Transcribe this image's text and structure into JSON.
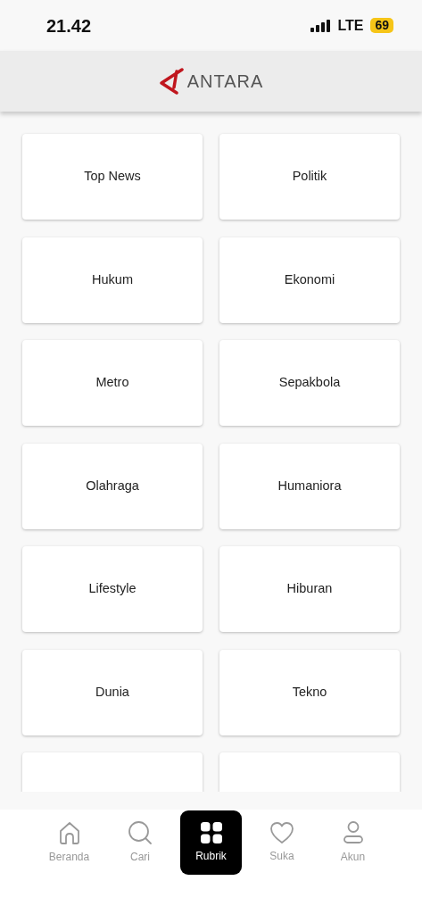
{
  "status_bar": {
    "time": "21.42",
    "network": "LTE",
    "battery": "69"
  },
  "header": {
    "logo_text": "ANTARA"
  },
  "categories": [
    {
      "kind": "card",
      "label": "Top News"
    },
    {
      "kind": "card",
      "label": "Politik"
    },
    {
      "kind": "card",
      "label": "Hukum"
    },
    {
      "kind": "card",
      "label": "Ekonomi"
    },
    {
      "kind": "card",
      "label": "Metro"
    },
    {
      "kind": "card",
      "label": "Sepakbola"
    },
    {
      "kind": "card",
      "label": "Olahraga"
    },
    {
      "kind": "card",
      "label": "Humaniora"
    },
    {
      "kind": "card",
      "label": "Lifestyle"
    },
    {
      "kind": "card",
      "label": "Hiburan"
    },
    {
      "kind": "card",
      "label": "Dunia"
    },
    {
      "kind": "card",
      "label": "Tekno"
    },
    {
      "kind": "cut"
    },
    {
      "kind": "cut"
    }
  ],
  "tab_bar": [
    {
      "kind": "home",
      "label": "Beranda",
      "selected": false
    },
    {
      "kind": "search",
      "label": "Cari",
      "selected": false
    },
    {
      "kind": "grid",
      "label": "Rubrik",
      "selected": true
    },
    {
      "kind": "heart",
      "label": "Suka",
      "selected": false
    },
    {
      "kind": "user",
      "label": "Akun",
      "selected": false
    }
  ]
}
